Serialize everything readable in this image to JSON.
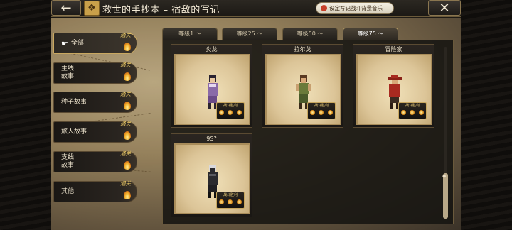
{
  "header": {
    "back_icon": "←",
    "title": "救世的手抄本 – 宿敌的写记",
    "music_button_label": "设定写记战斗背景音乐",
    "close_icon": "✕"
  },
  "menu": {
    "cleared_badge": "通关",
    "items": [
      {
        "label": "全部",
        "active": true
      },
      {
        "label": "主线\n故事",
        "active": false
      },
      {
        "label": "种子故事",
        "active": false
      },
      {
        "label": "旅人故事",
        "active": false
      },
      {
        "label": "支线\n故事",
        "active": false
      },
      {
        "label": "其他",
        "active": false
      }
    ]
  },
  "tabs": [
    {
      "label": "等级1 ～",
      "active": false
    },
    {
      "label": "等级25 ～",
      "active": false
    },
    {
      "label": "等级50 ～",
      "active": false
    },
    {
      "label": "等级75 ～",
      "active": true
    }
  ],
  "cards": [
    {
      "name": "炎龙",
      "stamp_label": "战斗胜利",
      "sprite_colors": {
        "body": "#8a6aa8",
        "hair": "#2a2230",
        "accent": "#e6d8f0"
      }
    },
    {
      "name": "拉尔戈",
      "stamp_label": "战斗胜利",
      "sprite_colors": {
        "body": "#6a7a3a",
        "hair": "#5a3a22",
        "accent": "#c8a070"
      }
    },
    {
      "name": "冒险家",
      "stamp_label": "战斗胜利",
      "sprite_colors": {
        "body": "#a82a20",
        "hair": "#8a2218",
        "accent": "#3a2a20"
      }
    },
    {
      "name": "9S?",
      "stamp_label": "战斗胜利",
      "sprite_colors": {
        "body": "#2a2a2e",
        "hair": "#d8d8dc",
        "accent": "#5a5a60"
      }
    }
  ]
}
